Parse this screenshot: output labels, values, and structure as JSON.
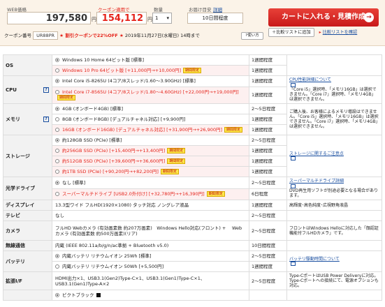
{
  "header": {
    "web_price_label": "WEB価格",
    "web_price": "197,580",
    "yen": "円",
    "coupon_price_label": "クーポン適用で",
    "coupon_price": "154,112",
    "qty_label": "数量",
    "qty_value": "1",
    "delivery_label": "お届け目安",
    "delivery_detail": "詳細",
    "delivery_value": "10日間程度",
    "cart_button": "カートに入れる・見積作成",
    "cart_arrow": "→",
    "coupon_code_label": "クーポン番号",
    "coupon_code": "UR88PR",
    "coupon_offer": "★ 割引クーポンで22%OFF ★",
    "coupon_deadline": "2019年11月27日(水曜日) 14時まで",
    "howto_button": "?使い方",
    "compare_add": "比較リストに追加",
    "compare_view": "比較リストを確認"
  },
  "rows": [
    {
      "cat": "OS",
      "help": false,
      "options": [
        {
          "text": "Windows 10 Home 64ビット版 [標準]",
          "sel": true,
          "ltd": false,
          "dl": "1週間程度"
        },
        {
          "text": "Windows 10 Pro 64ビット版 [+11,000円→+10,000円]",
          "sel": false,
          "ltd": true,
          "dl": "1週間程度"
        }
      ],
      "note": ""
    },
    {
      "cat": "CPU",
      "help": true,
      "options": [
        {
          "text": "Intel Core i5-8265U (4コア/8スレッド/1.60～3.90GHz) [標準]",
          "sel": true,
          "ltd": false,
          "dl": "1週間程度"
        },
        {
          "text": "Intel Core i7-8565U (4コア/8スレッド/1.80～4.60GHz) [+22,000円→+19,000円]",
          "sel": false,
          "ltd": true,
          "dl": "1週間程度"
        }
      ],
      "note_link": "CPU性能詳細について",
      "note": "「Core i5」選択時、「メモリ16GB」は選択できません。「Core i7」選択時、「メモリ4GB」は選択できません。"
    },
    {
      "cat": "メモリ",
      "help": true,
      "options": [
        {
          "text": "4GB (オンボード4GB) [標準]",
          "sel": true,
          "ltd": false,
          "dl": "2～5日程度"
        },
        {
          "text": "8GB (オンボード8GB) [デュアルチャネル対応] [+9,900円]",
          "sel": false,
          "ltd": false,
          "dl": "1週間程度"
        },
        {
          "text": "16GB (オンボード16GB) [デュアルチャネル対応] [+31,900円→+26,900円]",
          "sel": false,
          "ltd": true,
          "dl": "1週間程度"
        }
      ],
      "note_link": "",
      "note": "ご購入後、お客様によるメモリ増設はできません。「Core i5」選択時、「メモリ16GB」は選択できません。「Core i7」選択時、「メモリ4GB」は選択できません。"
    },
    {
      "cat": "ストレージ",
      "help": false,
      "options": [
        {
          "text": "約128GB SSD (PCIe) [標準]",
          "sel": true,
          "ltd": false,
          "dl": "2～5日程度"
        },
        {
          "text": "約256GB SSD (PCIe) [+15,400円→+13,400円]",
          "sel": false,
          "ltd": true,
          "dl": "1週間程度"
        },
        {
          "text": "約512GB SSD (PCIe) [+39,600円→+36,600円]",
          "sel": false,
          "ltd": true,
          "dl": "1週間程度"
        },
        {
          "text": "約1TB SSD (PCIe) [+90,200円→+82,200円]",
          "sel": false,
          "ltd": true,
          "dl": "1週間程度"
        }
      ],
      "note_link": "ストレージに関するご注意点",
      "note": ""
    },
    {
      "cat": "光学ドライブ",
      "help": false,
      "options": [
        {
          "text": "なし [標準]",
          "sel": true,
          "ltd": false,
          "dl": "2～5日程度"
        },
        {
          "text": "スーパーマルチドライブ [USB2.0外付け] [+32,780円→+16,390円]",
          "sel": false,
          "ltd": true,
          "dl": "6日程度"
        }
      ],
      "note_link": "スーパーマルチドライブ詳細",
      "note": "DVD再生用ソフトが別途必要となる場合があります。"
    },
    {
      "cat": "ディスプレイ",
      "help": false,
      "static": "13.3型ワイド フルHD(1920×1080) タッチ対応 ノングレア液晶",
      "dl": "1週間程度",
      "note": "高輝度･高色純度･広視野角液晶"
    },
    {
      "cat": "テレビ",
      "help": false,
      "static": "なし",
      "dl": "2～5日程度",
      "note": ""
    },
    {
      "cat": "カメラ",
      "help": false,
      "static": "フルHD Webカメラ (有効画素数 約207万画素)　Windows Hello対応(フロント) + 　Webカメラ (有効画素数 約500万画素)(リア)",
      "dl": "2～5日程度",
      "note": "フロントはWindows Helloに対応した「顔認証機能付フルHDカメラ」です。"
    },
    {
      "cat": "無線通信",
      "help": false,
      "static": "内蔵 (IEEE 802.11a/b/g/n/ac準拠 + Bluetooth v5.0)",
      "dl": "10日間程度",
      "note": ""
    },
    {
      "cat": "バッテリ",
      "help": false,
      "options": [
        {
          "text": "内蔵バッテリ リチウムイオン 25Wh [標準]",
          "sel": true,
          "ltd": false,
          "dl": "2～5日程度"
        },
        {
          "text": "内蔵バッテリ リチウムイオン 50Wh [+5,500円]",
          "sel": false,
          "ltd": false,
          "dl": "1週間程度"
        }
      ],
      "note_link": "バッテリ駆動時間について",
      "note": ""
    },
    {
      "cat": "拡張I/F",
      "help": false,
      "static": "HDMI出力×1、USB3.1(Gen2)Type-C×1、USB3.1(Gen1)Type-C×1、USB3.1(Gen1)Type-A×2",
      "dl": "2～5日程度",
      "note": "Type-CポートはUSB Power Deliveryに対応。Type-Cポートへの接続にて、電源オプションも対応。"
    },
    {
      "cat": "",
      "help": false,
      "options": [
        {
          "text": "ピクトブラック",
          "sel": true,
          "ltd": false,
          "dl": "",
          "swatch": true
        }
      ],
      "note": ""
    }
  ],
  "ltd_label": "期間限定"
}
